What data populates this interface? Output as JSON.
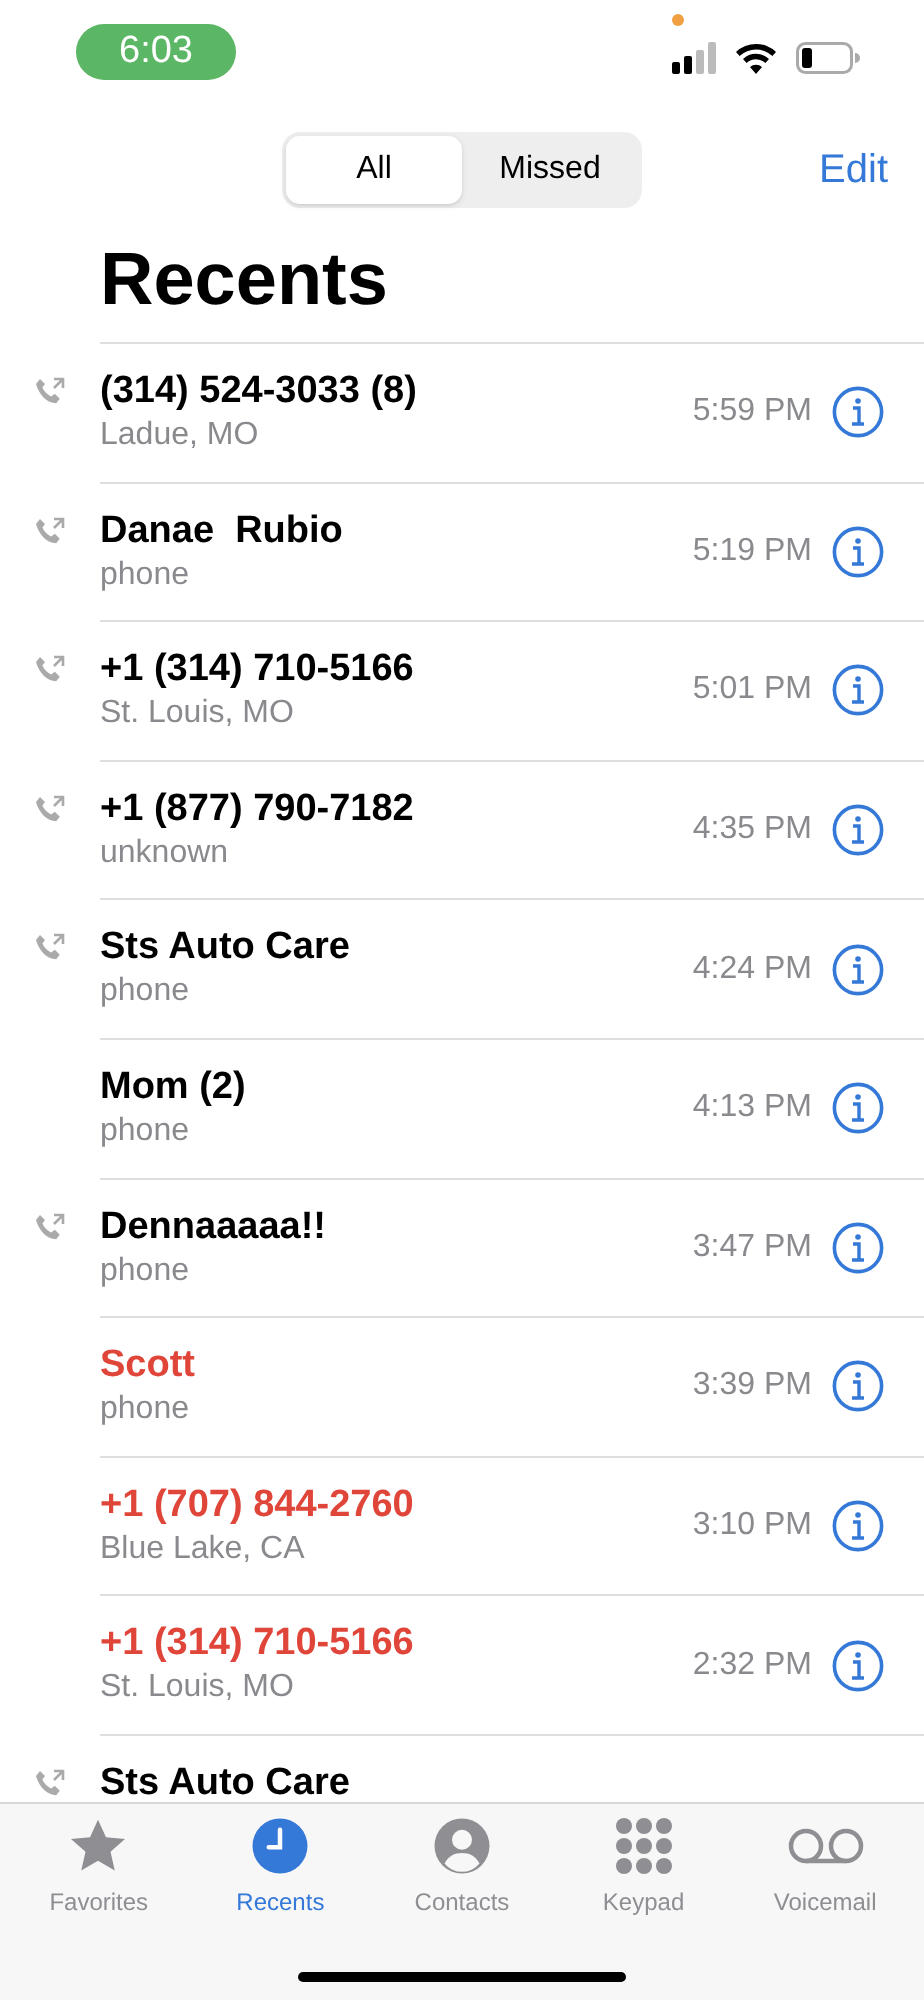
{
  "status_bar": {
    "time": "6:03"
  },
  "segments": [
    {
      "label": "All",
      "selected": true
    },
    {
      "label": "Missed",
      "selected": false
    }
  ],
  "edit_button": "Edit",
  "title": "Recents",
  "calls": [
    {
      "name": "(314) 524-3033 (8)",
      "detail": "Ladue, MO",
      "time": "5:59 PM",
      "outgoing": true,
      "missed": false
    },
    {
      "name": "Danae  Rubio",
      "detail": "phone",
      "time": "5:19 PM",
      "outgoing": true,
      "missed": false
    },
    {
      "name": "+1 (314) 710-5166",
      "detail": "St. Louis, MO",
      "time": "5:01 PM",
      "outgoing": true,
      "missed": false
    },
    {
      "name": "+1 (877) 790-7182",
      "detail": "unknown",
      "time": "4:35 PM",
      "outgoing": true,
      "missed": false
    },
    {
      "name": "Sts Auto Care",
      "detail": "phone",
      "time": "4:24 PM",
      "outgoing": true,
      "missed": false
    },
    {
      "name": "Mom (2)",
      "detail": "phone",
      "time": "4:13 PM",
      "outgoing": false,
      "missed": false
    },
    {
      "name": "Dennaaaaa!!",
      "detail": "phone",
      "time": "3:47 PM",
      "outgoing": true,
      "missed": false
    },
    {
      "name": "Scott",
      "detail": "phone",
      "time": "3:39 PM",
      "outgoing": false,
      "missed": true
    },
    {
      "name": "+1 (707) 844-2760",
      "detail": "Blue Lake, CA",
      "time": "3:10 PM",
      "outgoing": false,
      "missed": true
    },
    {
      "name": "+1 (314) 710-5166",
      "detail": "St. Louis, MO",
      "time": "2:32 PM",
      "outgoing": false,
      "missed": true
    },
    {
      "name": "Sts Auto Care",
      "outgoing": true,
      "missed": false
    }
  ],
  "tab_bar": [
    {
      "kind": "favorites",
      "label": "Favorites",
      "selected": false
    },
    {
      "kind": "recents",
      "label": "Recents",
      "selected": true
    },
    {
      "kind": "contacts",
      "label": "Contacts",
      "selected": false
    },
    {
      "kind": "keypad",
      "label": "Keypad",
      "selected": false
    },
    {
      "kind": "voicemail",
      "label": "Voicemail",
      "selected": false
    }
  ]
}
